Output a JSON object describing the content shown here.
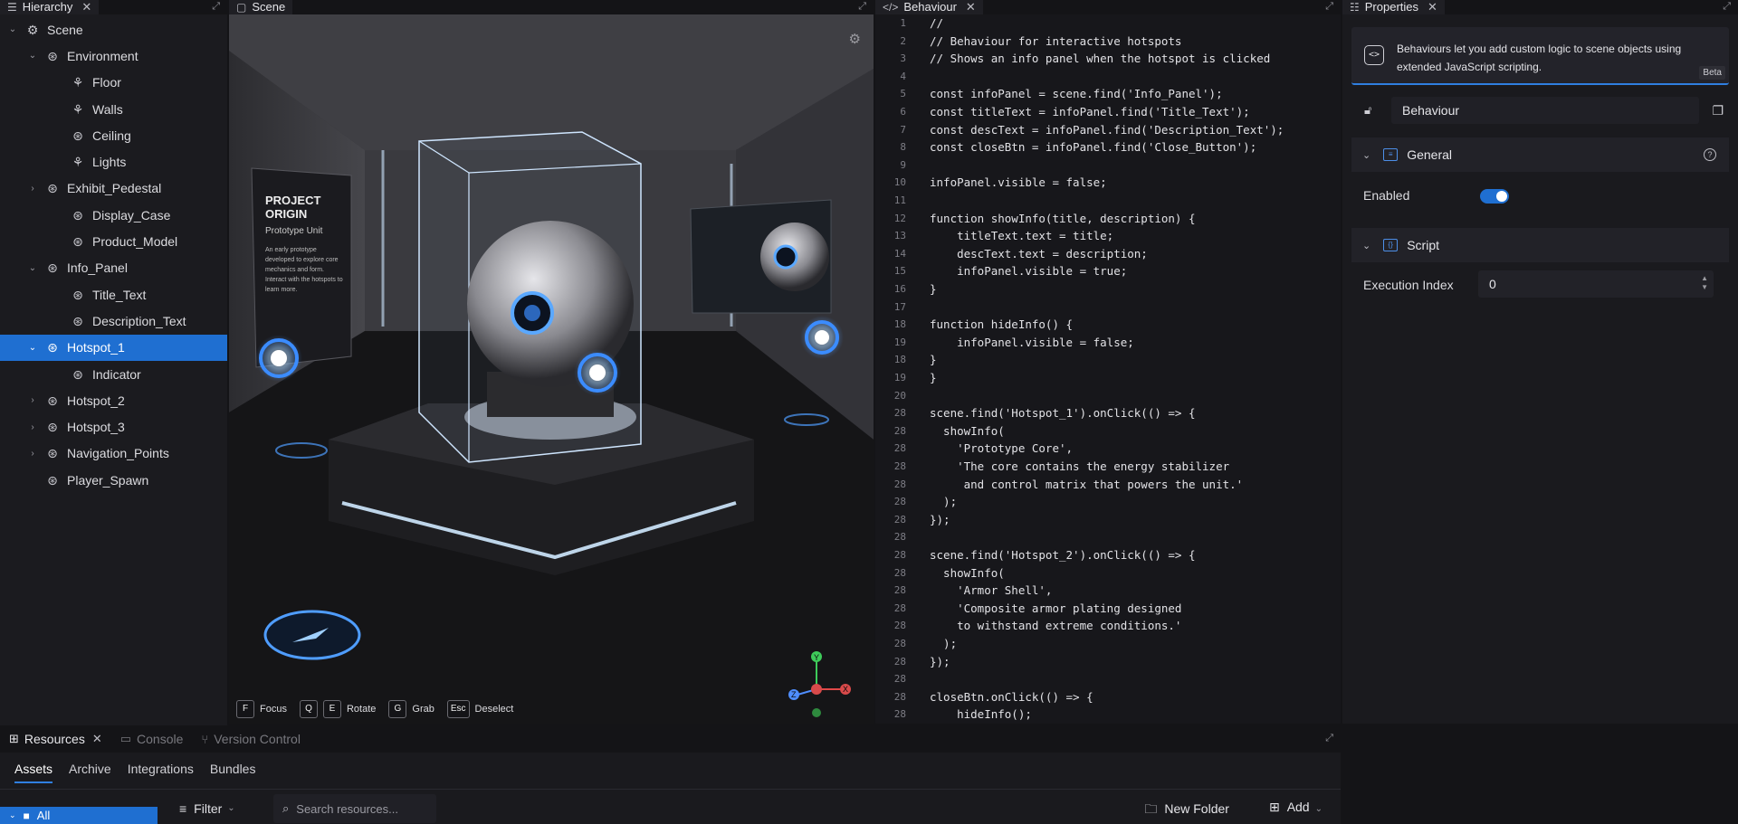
{
  "hierarchy": {
    "tab_label": "Hierarchy",
    "nodes": [
      {
        "label": "Scene",
        "depth": 0,
        "chevron": "open"
      },
      {
        "label": "Environment",
        "depth": 1,
        "chevron": "open"
      },
      {
        "label": "Floor",
        "depth": 2,
        "chevron": "none"
      },
      {
        "label": "Walls",
        "depth": 2,
        "chevron": "none"
      },
      {
        "label": "Ceiling",
        "depth": 2,
        "chevron": "none"
      },
      {
        "label": "Lights",
        "depth": 2,
        "chevron": "none"
      },
      {
        "label": "Exhibit_Pedestal",
        "depth": 1,
        "chevron": "closed"
      },
      {
        "label": "Display_Case",
        "depth": 2,
        "chevron": "none"
      },
      {
        "label": "Product_Model",
        "depth": 2,
        "chevron": "none"
      },
      {
        "label": "Info_Panel",
        "depth": 1,
        "chevron": "open"
      },
      {
        "label": "Title_Text",
        "depth": 2,
        "chevron": "none"
      },
      {
        "label": "Description_Text",
        "depth": 2,
        "chevron": "none"
      },
      {
        "label": "Hotspot_1",
        "depth": 1,
        "chevron": "open",
        "selected": true
      },
      {
        "label": "Indicator",
        "depth": 2,
        "chevron": "none"
      },
      {
        "label": "Hotspot_2",
        "depth": 1,
        "chevron": "closed"
      },
      {
        "label": "Hotspot_3",
        "depth": 1,
        "chevron": "closed"
      },
      {
        "label": "Navigation_Points",
        "depth": 1,
        "chevron": "closed"
      },
      {
        "label": "Player_Spawn",
        "depth": 1,
        "chevron": "none"
      }
    ]
  },
  "scene": {
    "tab_label": "Scene",
    "poster_title": "PROJECT ORIGIN",
    "poster_subtitle": "Prototype Unit",
    "poster_body": "An early prototype developed to explore core mechanics and form. Interact with the hotspots to learn more.",
    "gizmo": {
      "x": "X",
      "y": "Y",
      "z": "Z"
    },
    "hints": [
      {
        "key": "F",
        "label": "Focus"
      },
      {
        "key": "Q",
        "label": ""
      },
      {
        "key": "E",
        "label": "Rotate"
      },
      {
        "key": "G",
        "label": "Grab"
      },
      {
        "key": "Esc",
        "label": "Deselect"
      }
    ]
  },
  "behaviour": {
    "tab_label": "Behaviour",
    "lines": [
      {
        "n": "1",
        "code": "//"
      },
      {
        "n": "2",
        "code": "// Behaviour for interactive hotspots"
      },
      {
        "n": "3",
        "code": "// Shows an info panel when the hotspot is clicked"
      },
      {
        "n": "4",
        "code": ""
      },
      {
        "n": "5",
        "code": "const infoPanel = scene.find('Info_Panel');"
      },
      {
        "n": "6",
        "code": "const titleText = infoPanel.find('Title_Text');"
      },
      {
        "n": "7",
        "code": "const descText = infoPanel.find('Description_Text');"
      },
      {
        "n": "8",
        "code": "const closeBtn = infoPanel.find('Close_Button');"
      },
      {
        "n": "9",
        "code": ""
      },
      {
        "n": "10",
        "code": "infoPanel.visible = false;"
      },
      {
        "n": "11",
        "code": ""
      },
      {
        "n": "12",
        "code": "function showInfo(title, description) {"
      },
      {
        "n": "13",
        "code": "    titleText.text = title;"
      },
      {
        "n": "14",
        "code": "    descText.text = description;"
      },
      {
        "n": "15",
        "code": "    infoPanel.visible = true;"
      },
      {
        "n": "16",
        "code": "}"
      },
      {
        "n": "17",
        "code": ""
      },
      {
        "n": "18",
        "code": "function hideInfo() {"
      },
      {
        "n": "19",
        "code": "    infoPanel.visible = false;"
      },
      {
        "n": "18",
        "code": "}"
      },
      {
        "n": "19",
        "code": "}"
      },
      {
        "n": "20",
        "code": ""
      },
      {
        "n": "28",
        "code": "scene.find('Hotspot_1').onClick(() => {"
      },
      {
        "n": "28",
        "code": "  showInfo("
      },
      {
        "n": "28",
        "code": "    'Prototype Core',"
      },
      {
        "n": "28",
        "code": "    'The core contains the energy stabilizer"
      },
      {
        "n": "28",
        "code": "     and control matrix that powers the unit.'"
      },
      {
        "n": "28",
        "code": "  );"
      },
      {
        "n": "28",
        "code": "});"
      },
      {
        "n": "28",
        "code": ""
      },
      {
        "n": "28",
        "code": "scene.find('Hotspot_2').onClick(() => {"
      },
      {
        "n": "28",
        "code": "  showInfo("
      },
      {
        "n": "28",
        "code": "    'Armor Shell',"
      },
      {
        "n": "28",
        "code": "    'Composite armor plating designed"
      },
      {
        "n": "28",
        "code": "    to withstand extreme conditions.'"
      },
      {
        "n": "28",
        "code": "  );"
      },
      {
        "n": "28",
        "code": "});"
      },
      {
        "n": "28",
        "code": ""
      },
      {
        "n": "28",
        "code": "closeBtn.onClick(() => {"
      },
      {
        "n": "28",
        "code": "    hideInfo();"
      },
      {
        "n": "28",
        "code": "});"
      }
    ]
  },
  "properties": {
    "tab_label": "Properties",
    "banner_text": "Behaviours let you add custom logic to scene objects using extended JavaScript scripting.",
    "beta_label": "Beta",
    "component_name": "Behaviour",
    "general_title": "General",
    "enabled_label": "Enabled",
    "enabled_value": true,
    "script_title": "Script",
    "execution_index_label": "Execution Index",
    "execution_index_value": "0"
  },
  "resources": {
    "tabs": [
      {
        "label": "Resources",
        "active": true
      },
      {
        "label": "Console",
        "active": false
      },
      {
        "label": "Version Control",
        "active": false
      }
    ],
    "subtabs": [
      "Assets",
      "Archive",
      "Integrations",
      "Bundles"
    ],
    "filter_label": "Filter",
    "search_placeholder": "Search resources...",
    "new_folder_label": "New Folder",
    "add_label": "Add",
    "folder_all": "All"
  },
  "colors": {
    "accent": "#1f6fd1",
    "hotspot_glow": "#3b8cff"
  }
}
